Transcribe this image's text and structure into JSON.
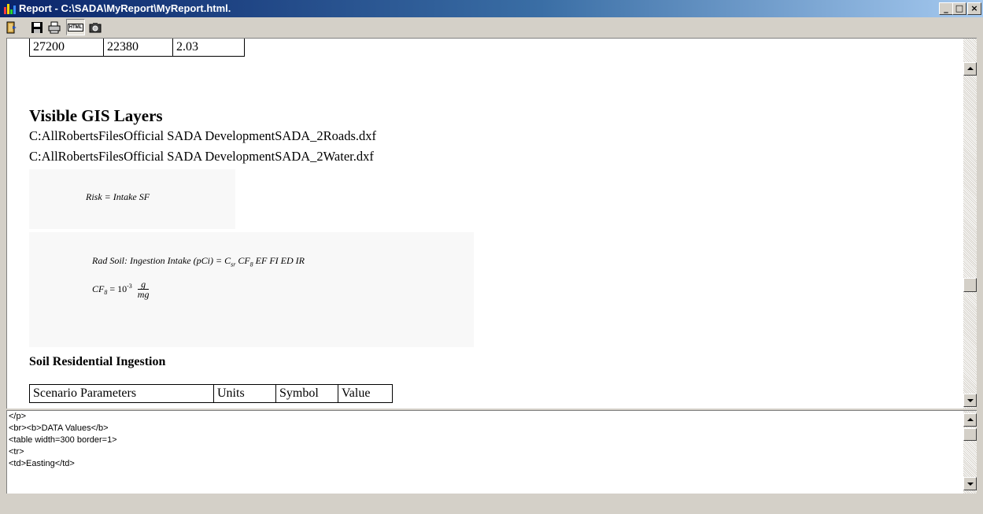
{
  "window": {
    "title": "Report - C:\\SADA\\MyReport\\MyReport.html."
  },
  "toolbar": {
    "buttons": [
      {
        "icon": "exit-icon"
      },
      {
        "icon": "save-icon"
      },
      {
        "icon": "print-icon"
      },
      {
        "icon": "html-view-icon",
        "label": "HTML",
        "pressed": true
      },
      {
        "icon": "camera-icon"
      }
    ]
  },
  "report": {
    "top_table_row": [
      "27200",
      "22380",
      "2.03"
    ],
    "gis_heading": "Visible GIS Layers",
    "gis_layers": [
      "C:AllRobertsFilesOfficial SADA DevelopmentSADA_2Roads.dxf",
      "C:AllRobertsFilesOfficial SADA DevelopmentSADA_2Water.dxf"
    ],
    "equation_risk": "Risk = Intake SF",
    "equation_rad_soil": {
      "prefix": "Rad Soil: Ingestion Intake (pCi) = C",
      "sub1": "sr",
      "mid": " CF",
      "sub2": "8",
      "suffix": " EF FI ED IR"
    },
    "equation_cf8": {
      "lhs": "CF",
      "lhs_sub": "8",
      "eq": "= 10",
      "exp": "-3",
      "num": "g",
      "den": "mg"
    },
    "soil_heading": "Soil Residential Ingestion",
    "param_headers": [
      "Scenario Parameters",
      "Units",
      "Symbol",
      "Value"
    ]
  },
  "source_lines": [
    "</p>",
    "<br><b>DATA Values</b>",
    "<table width=300 border=1>",
    "<tr>",
    "<td>Easting</td>"
  ]
}
